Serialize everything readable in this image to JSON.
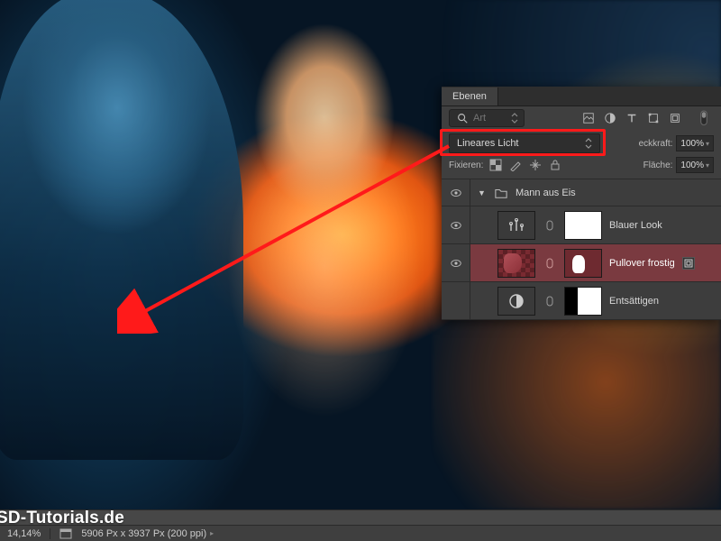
{
  "panel": {
    "title": "Ebenen",
    "search_placeholder": "Art",
    "blend_mode": "Lineares Licht",
    "opacity_label": "eckkraft:",
    "opacity_value": "100%",
    "fill_label": "Fläche:",
    "fill_value": "100%",
    "lock_label": "Fixieren:"
  },
  "layers": {
    "group_name": "Mann aus Eis",
    "items": [
      {
        "name": "Blauer Look",
        "kind": "adjustment"
      },
      {
        "name": "Pullover frostig",
        "kind": "pixel",
        "selected": true
      },
      {
        "name": "Entsättigen",
        "kind": "adjustment"
      }
    ]
  },
  "status": {
    "watermark": "SD-Tutorials.de",
    "zoom": "14,14%",
    "doc_info": "5906 Px x 3937 Px (200 ppi)"
  },
  "colors": {
    "highlight": "#ff1a1a",
    "selection": "#7a3a40"
  }
}
